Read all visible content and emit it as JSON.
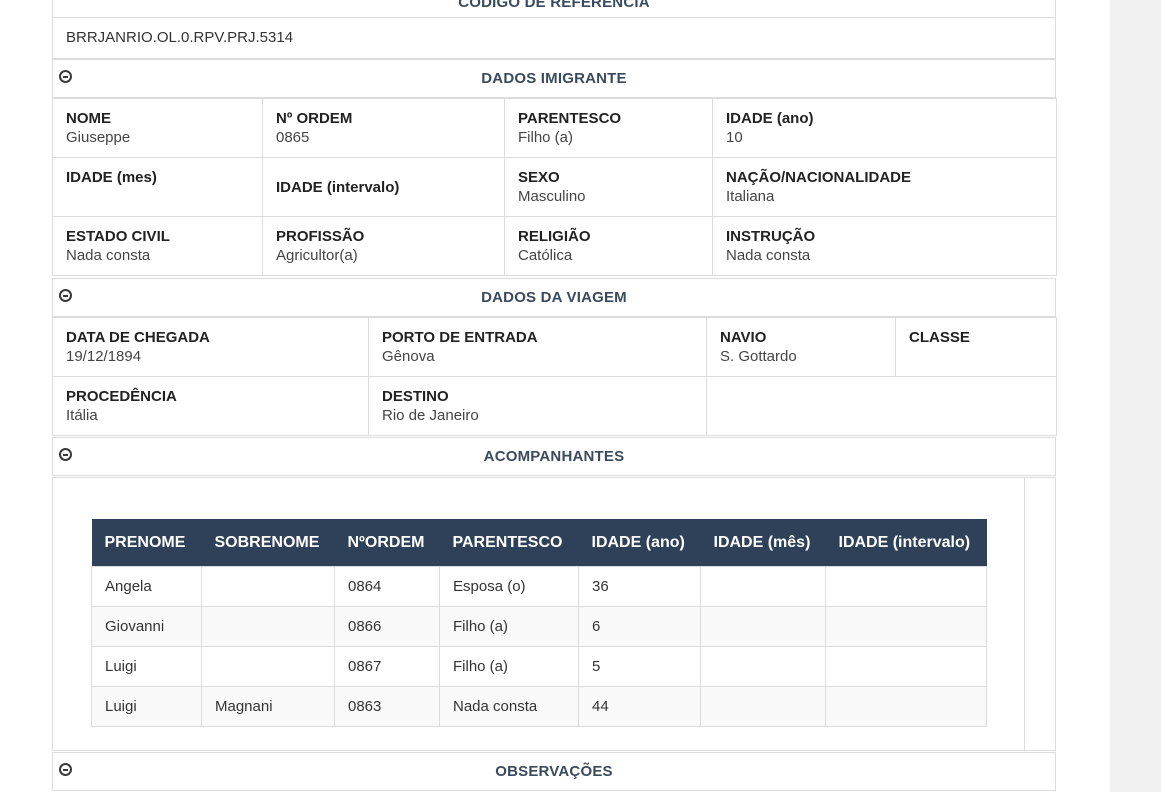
{
  "referencia": {
    "title": "CÓDIGO DE REFERÊNCIA",
    "value": "BRRJANRIO.OL.0.RPV.PRJ.5314"
  },
  "imigrante": {
    "title": "DADOS IMIGRANTE",
    "nome_label": "NOME",
    "nome": "Giuseppe",
    "ordem_label": "Nº ORDEM",
    "ordem": "0865",
    "parentesco_label": "PARENTESCO",
    "parentesco": "Filho (a)",
    "idade_ano_label": "IDADE (ano)",
    "idade_ano": "10",
    "idade_mes_label": "IDADE (mes)",
    "idade_mes": "",
    "idade_intervalo_label": "IDADE (intervalo)",
    "sexo_label": "SEXO",
    "sexo": "Masculino",
    "nacao_label": "NAÇÃO/NACIONALIDADE",
    "nacao": "Italiana",
    "estado_civil_label": "ESTADO CIVIL",
    "estado_civil": "Nada consta",
    "profissao_label": "PROFISSÃO",
    "profissao": "Agricultor(a)",
    "religiao_label": "RELIGIÃO",
    "religiao": "Católica",
    "instrucao_label": "INSTRUÇÃO",
    "instrucao": "Nada consta"
  },
  "viagem": {
    "title": "DADOS DA VIAGEM",
    "chegada_label": "DATA DE CHEGADA",
    "chegada": "19/12/1894",
    "porto_label": "PORTO DE ENTRADA",
    "porto": "Gênova",
    "navio_label": "NAVIO",
    "navio": "S. Gottardo",
    "classe_label": "CLASSE",
    "classe": "",
    "procedencia_label": "PROCEDÊNCIA",
    "procedencia": "Itália",
    "destino_label": "DESTINO",
    "destino": "Rio de Janeiro"
  },
  "acompanhantes": {
    "title": "ACOMPANHANTES",
    "columns": [
      "PRENOME",
      "SOBRENOME",
      "NºORDEM",
      "PARENTESCO",
      "IDADE (ano)",
      "IDADE (mês)",
      "IDADE (intervalo)"
    ],
    "rows": [
      [
        "Angela",
        "",
        "0864",
        "Esposa (o)",
        "36",
        "",
        ""
      ],
      [
        "Giovanni",
        "",
        "0866",
        "Filho (a)",
        "6",
        "",
        ""
      ],
      [
        "Luigi",
        "",
        "0867",
        "Filho (a)",
        "5",
        "",
        ""
      ],
      [
        "Luigi",
        "Magnani",
        "0863",
        "Nada consta",
        "44",
        "",
        ""
      ]
    ]
  },
  "observacoes": {
    "title": "OBSERVAÇÕES"
  }
}
